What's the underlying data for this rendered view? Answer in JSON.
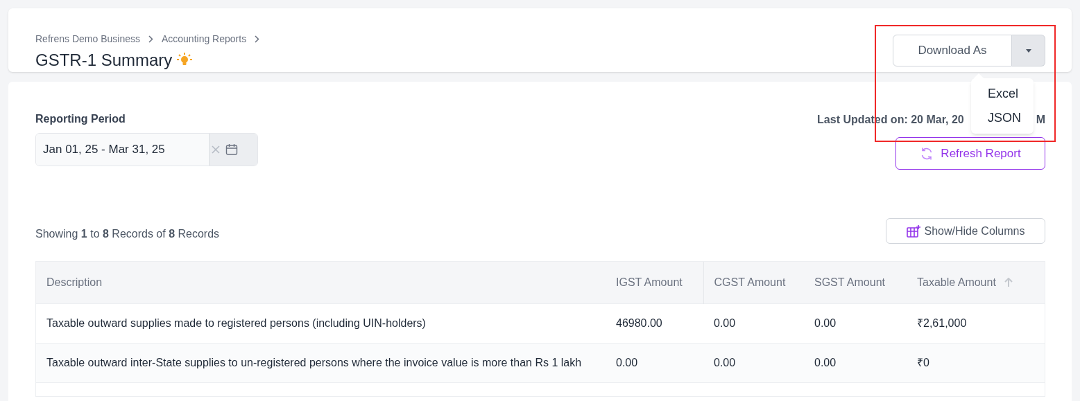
{
  "breadcrumbs": [
    "Refrens Demo Business",
    "Accounting Reports"
  ],
  "title": "GSTR-1 Summary",
  "download": {
    "label": "Download As",
    "menu_open": true,
    "menu": [
      "Excel",
      "JSON"
    ]
  },
  "reporting_period": {
    "label": "Reporting Period",
    "value": "Jan 01, 25 - Mar 31, 25"
  },
  "last_updated": {
    "visible_start": "Last Updated on: 20 Mar, 20",
    "visible_end": "M"
  },
  "refresh_button": "Refresh Report",
  "records_summary": "Showing **1** to **8** Records of **8** Records",
  "columns_button": "Show/Hide Columns",
  "table": {
    "columns": [
      {
        "label": "Description",
        "sorted": false
      },
      {
        "label": "IGST Amount",
        "sorted": false
      },
      {
        "label": "CGST Amount",
        "sorted": false
      },
      {
        "label": "SGST Amount",
        "sorted": false
      },
      {
        "label": "Taxable Amount",
        "sorted": true
      }
    ],
    "rows": [
      [
        "Taxable outward supplies made to registered persons (including UIN-holders)",
        "46980.00",
        "0.00",
        "0.00",
        "₹2,61,000"
      ],
      [
        "Taxable outward inter-State supplies to un-registered persons where the invoice value is more than Rs 1 lakh",
        "0.00",
        "0.00",
        "0.00",
        "₹0"
      ]
    ]
  }
}
